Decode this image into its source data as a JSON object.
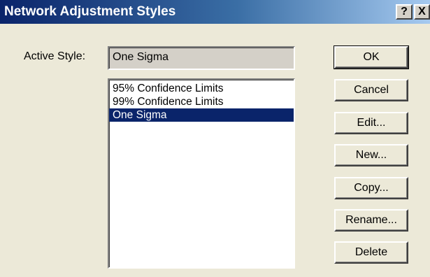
{
  "window": {
    "title": "Network Adjustment Styles",
    "help_label": "?",
    "close_label": "X"
  },
  "active_style": {
    "label": "Active Style:",
    "value": "One Sigma"
  },
  "styles_list": {
    "items": [
      {
        "label": "95% Confidence Limits",
        "selected": false
      },
      {
        "label": "99% Confidence Limits",
        "selected": false
      },
      {
        "label": "One Sigma",
        "selected": true
      }
    ]
  },
  "buttons": {
    "ok": "OK",
    "cancel": "Cancel",
    "edit": "Edit...",
    "new": "New...",
    "copy": "Copy...",
    "rename": "Rename...",
    "delete": "Delete"
  },
  "colors": {
    "selection": "#0a246a",
    "titlebar": "#0a246a",
    "dialog_face": "#ece9d8"
  }
}
